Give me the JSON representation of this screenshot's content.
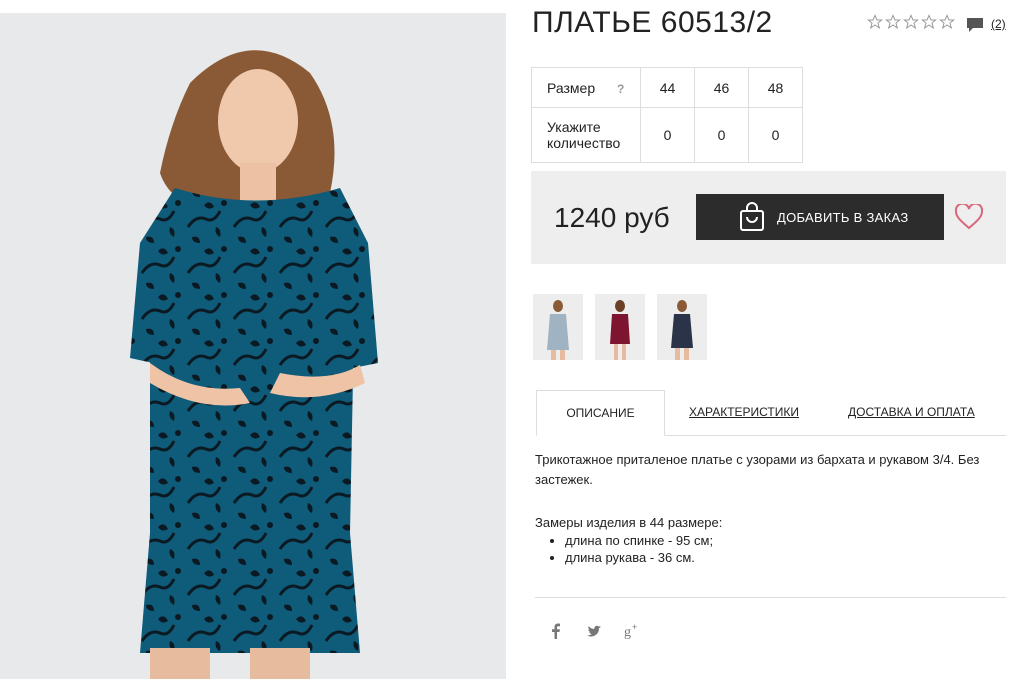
{
  "product": {
    "title": "ПЛАТЬЕ 60513/2",
    "rating_stars": 0,
    "reviews_count": "(2)"
  },
  "sizes": {
    "size_label": "Размер",
    "help_icon": "?",
    "qty_label": "Укажите количество",
    "values": [
      "44",
      "46",
      "48"
    ],
    "quantities": [
      "0",
      "0",
      "0"
    ]
  },
  "purchase": {
    "price": "1240 руб",
    "order_button": "ДОБАВИТЬ В ЗАКАЗ"
  },
  "tabs": [
    "ОПИСАНИЕ",
    "ХАРАКТЕРИСТИКИ",
    "ДОСТАВКА И ОПЛАТА"
  ],
  "description": {
    "text": "Трикотажное приталеное платье с узорами из бархата и рукавом 3/4. Без застежек.",
    "measures_title": "Замеры изделия в 44 размере:",
    "measures": [
      "длина по спинке - 95 см;",
      "длина рукава - 36 см."
    ]
  },
  "colors": {
    "dress_main": "#0f5b7a",
    "thumb_colors": [
      "#9fb3c2",
      "#7d1530",
      "#2b3348"
    ],
    "button_bg": "#2c2c2c",
    "heart": "#d9667a"
  },
  "icons": {
    "social": [
      "facebook-icon",
      "twitter-icon",
      "google-plus-icon"
    ]
  }
}
